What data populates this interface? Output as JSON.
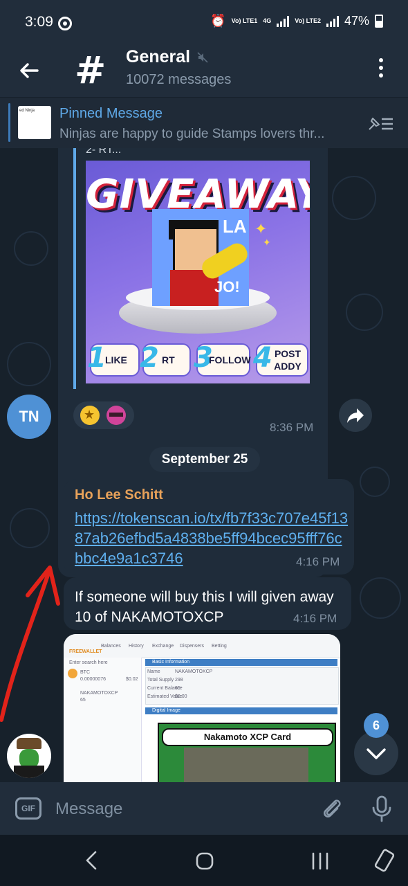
{
  "status_bar": {
    "time": "3:09",
    "sim1_label": "Vo) LTE1",
    "net_label": "4G",
    "sim2_label": "Vo) LTE2",
    "battery": "47%"
  },
  "header": {
    "title": "General",
    "subtitle": "10072 messages"
  },
  "pinned": {
    "title": "Pinned Message",
    "text": "Ninjas are happy to guide Stamps lovers thr...",
    "thumb_text": "ed Ninja"
  },
  "messages": {
    "quoted_snippet": "2- RT...",
    "giveaway": {
      "title": "GIVEAWAY",
      "art_text_1": "LA",
      "art_text_2": "JO!",
      "steps": [
        {
          "num": "1",
          "label": "LIKE"
        },
        {
          "num": "2",
          "label": "RT"
        },
        {
          "num": "3",
          "label": "FOLLOW"
        },
        {
          "num": "4",
          "label": "POST ADDY"
        }
      ]
    },
    "first_time": "8:36 PM",
    "first_avatar_initials": "TN",
    "date_separator": "September 25",
    "link_message": {
      "sender": "Ho Lee Schitt",
      "url": "https://tokenscan.io/tx/fb7f33c707e45f1387ab26efbd5a4838be5ff94bcec95fff76cbbc4e9a1c3746",
      "time": "4:16 PM"
    },
    "text_message": {
      "text": "If someone will buy this I will given away 10 of NAKAMOTOXCP",
      "time": "4:16 PM"
    },
    "screenshot": {
      "app_name": "FREEWALLET",
      "tabs": [
        "Balances",
        "History",
        "Exchange",
        "Dispensers",
        "Betting"
      ],
      "search_placeholder": "Enter search here",
      "asset_btc": "BTC",
      "asset_btc_value": "0.00000076",
      "asset_btc_usd": "$0.02",
      "asset_selected": "NAKAMOTOXCP",
      "asset_selected_qty": "65",
      "info_header": "Basic Information",
      "info_rows": [
        {
          "label": "Name",
          "value": "NAKAMOTOXCP"
        },
        {
          "label": "Total Supply",
          "value": "298"
        },
        {
          "label": "Current Balance",
          "value": "65"
        },
        {
          "label": "Estimated Value",
          "value": "$0.00"
        }
      ],
      "digital_image_header": "Digital Image",
      "card_title": "Nakamoto XCP Card"
    },
    "unread_count": "6"
  },
  "input": {
    "gif_label": "GIF",
    "placeholder": "Message"
  }
}
